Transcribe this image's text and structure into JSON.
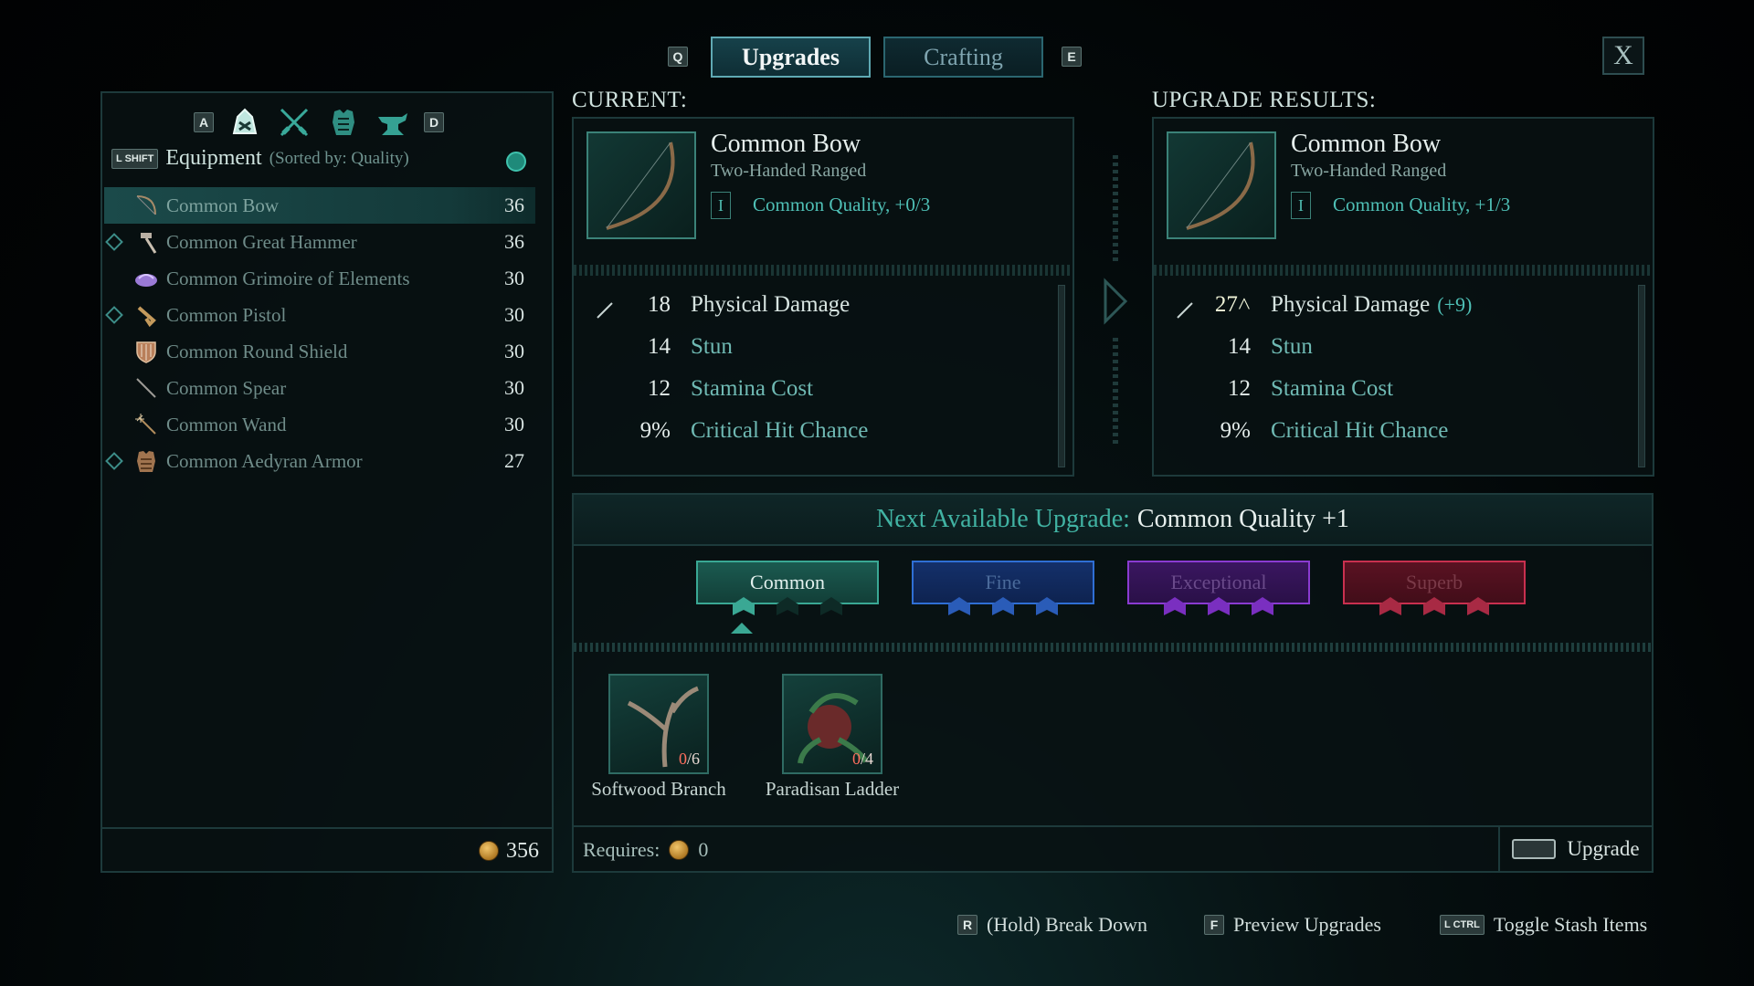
{
  "tabs": {
    "left_key": "Q",
    "right_key": "E",
    "items": [
      {
        "label": "Upgrades",
        "active": true
      },
      {
        "label": "Crafting",
        "active": false
      }
    ],
    "close_label": "X"
  },
  "inventory": {
    "category_prev_key": "A",
    "category_next_key": "D",
    "category_icons": [
      "all-items-icon",
      "weapons-icon",
      "armor-icon",
      "crafting-anvil-icon"
    ],
    "sort_key": "L SHIFT",
    "title": "Equipment",
    "sort_text": "(Sorted by: Quality)",
    "items": [
      {
        "name": "Common Bow",
        "level": "36",
        "icon": "bow-icon",
        "selected": true,
        "marked": false
      },
      {
        "name": "Common Great Hammer",
        "level": "36",
        "icon": "hammer-icon",
        "selected": false,
        "marked": true
      },
      {
        "name": "Common Grimoire of Elements",
        "level": "30",
        "icon": "grimoire-icon",
        "selected": false,
        "marked": false
      },
      {
        "name": "Common Pistol",
        "level": "30",
        "icon": "pistol-icon",
        "selected": false,
        "marked": true
      },
      {
        "name": "Common Round Shield",
        "level": "30",
        "icon": "shield-icon",
        "selected": false,
        "marked": false
      },
      {
        "name": "Common Spear",
        "level": "30",
        "icon": "spear-icon",
        "selected": false,
        "marked": false
      },
      {
        "name": "Common Wand",
        "level": "30",
        "icon": "wand-icon",
        "selected": false,
        "marked": false
      },
      {
        "name": "Common Aedyran Armor",
        "level": "27",
        "icon": "armor-icon",
        "selected": false,
        "marked": true
      }
    ],
    "gold": "356"
  },
  "current": {
    "label": "CURRENT:",
    "name": "Common Bow",
    "type": "Two-Handed Ranged",
    "quality_tier": "I",
    "quality_text": "Common Quality, +0/3",
    "stats": [
      {
        "value": "18",
        "label": "Physical Damage",
        "bonus": ""
      },
      {
        "value": "14",
        "label": "Stun",
        "bonus": ""
      },
      {
        "value": "12",
        "label": "Stamina Cost",
        "bonus": ""
      },
      {
        "value": "9%",
        "label": "Critical Hit Chance",
        "bonus": ""
      }
    ]
  },
  "result": {
    "label": "UPGRADE RESULTS:",
    "name": "Common Bow",
    "type": "Two-Handed Ranged",
    "quality_tier": "I",
    "quality_text": "Common Quality, +1/3",
    "stats": [
      {
        "value": "27˄",
        "label": "Physical Damage",
        "bonus": "(+9)"
      },
      {
        "value": "14",
        "label": "Stun",
        "bonus": ""
      },
      {
        "value": "12",
        "label": "Stamina Cost",
        "bonus": ""
      },
      {
        "value": "9%",
        "label": "Critical Hit Chance",
        "bonus": ""
      }
    ]
  },
  "upgrade": {
    "next_label": "Next Available Upgrade:",
    "next_value": "Common Quality +1",
    "tiers": [
      {
        "label": "Common",
        "color": "#3aa894",
        "active": true
      },
      {
        "label": "Fine",
        "color": "#2f6fd4",
        "active": false
      },
      {
        "label": "Exceptional",
        "color": "#8a3bd1",
        "active": false
      },
      {
        "label": "Superb",
        "color": "#c9304f",
        "active": false
      }
    ],
    "materials": [
      {
        "name": "Softwood Branch",
        "have": "0",
        "need": "/6"
      },
      {
        "name": "Paradisan Ladder",
        "have": "0",
        "need": "/4"
      }
    ],
    "requires_label": "Requires:",
    "requires_gold": "0",
    "button_label": "Upgrade"
  },
  "footer": [
    {
      "key": "R",
      "label": "(Hold) Break Down"
    },
    {
      "key": "F",
      "label": "Preview Upgrades"
    },
    {
      "key": "L CTRL",
      "label": "Toggle Stash Items"
    }
  ]
}
